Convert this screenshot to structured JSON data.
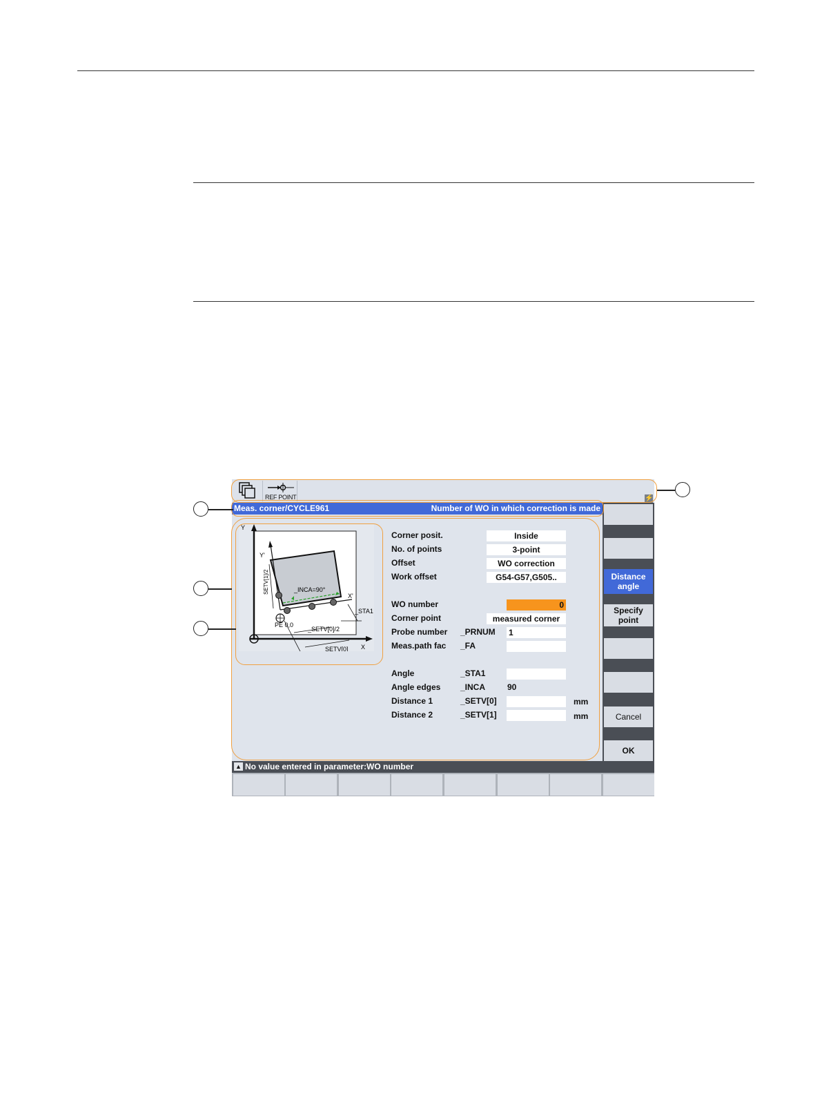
{
  "topbar": {
    "ref_point_label": "REF POINT"
  },
  "title": {
    "left": "Meas. corner/CYCLE961",
    "right": "Number of WO in which correction is made"
  },
  "diagram": {
    "axis_y": "Y",
    "axis_x": "X",
    "axis_y_prime": "Y'",
    "axis_x_prime": "X'",
    "setv1_half": "SETV[1]/2",
    "inca": "_INCA=90°",
    "sta1": "_STA1",
    "pe": "PE 0,0",
    "setv0_half": "_SETV[0]/2",
    "setv0": "_SETV[0]"
  },
  "form": {
    "corner_posit": {
      "label": "Corner posit.",
      "value": "Inside"
    },
    "no_points": {
      "label": "No. of points",
      "value": "3-point"
    },
    "offset": {
      "label": "Offset",
      "value": "WO correction"
    },
    "work_offset": {
      "label": "Work offset",
      "value": "G54-G57,G505.."
    },
    "wo_number": {
      "label": "WO number",
      "value": "0"
    },
    "corner_point": {
      "label": "Corner point",
      "value": "measured corner"
    },
    "probe_number": {
      "label": "Probe number",
      "param": "_PRNUM",
      "value": "1"
    },
    "meas_path": {
      "label": "Meas.path fac",
      "param": "_FA",
      "value": ""
    },
    "angle": {
      "label": "Angle",
      "param": "_STA1",
      "value": ""
    },
    "angle_edges": {
      "label": "Angle edges",
      "param": "_INCA",
      "value": "90"
    },
    "distance1": {
      "label": "Distance 1",
      "param": "_SETV[0]",
      "value": "",
      "unit": "mm"
    },
    "distance2": {
      "label": "Distance 2",
      "param": "_SETV[1]",
      "value": "",
      "unit": "mm"
    }
  },
  "softkeys_vertical": [
    {
      "label": ""
    },
    {
      "label": ""
    },
    {
      "label": "Distance\nangle"
    },
    {
      "label": "Specify\npoint"
    },
    {
      "label": ""
    },
    {
      "label": ""
    },
    {
      "label": "Cancel"
    },
    {
      "label": "OK"
    }
  ],
  "status": {
    "text": "No value entered in parameter:WO number"
  },
  "colors": {
    "title_bar": "#4169d8",
    "active_field": "#f7941d",
    "callout": "#f0a040"
  }
}
